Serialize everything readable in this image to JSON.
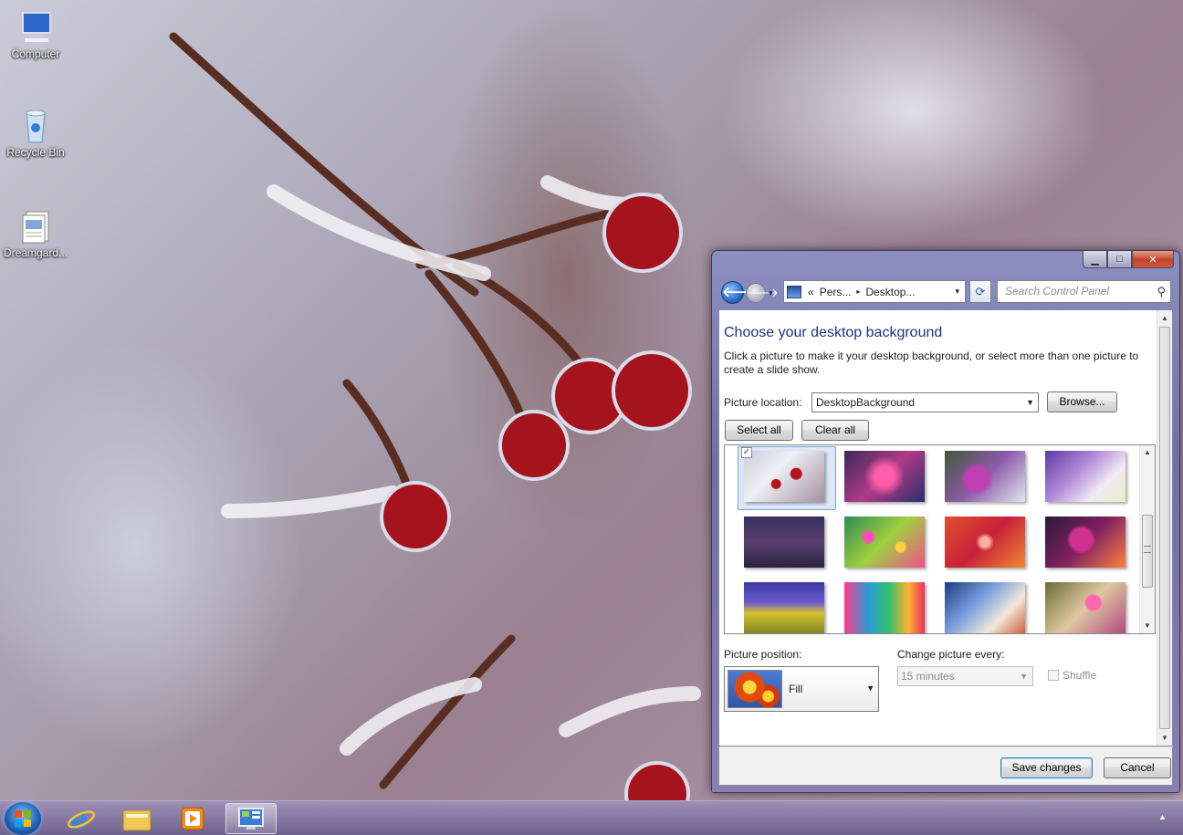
{
  "desktop": {
    "icons": [
      {
        "label": "Computer",
        "icon": "computer-icon"
      },
      {
        "label": "Recycle Bin",
        "icon": "recycle-bin-icon"
      },
      {
        "label": "Dreamgard...",
        "icon": "document-icon"
      }
    ]
  },
  "window": {
    "caption_buttons": {
      "minimize": "▁",
      "maximize": "□",
      "close": "✕"
    },
    "nav": {
      "back": "🡐",
      "forward": "🡒",
      "address": {
        "overflow": "«",
        "segments": [
          "Pers...",
          "Desktop..."
        ],
        "separator": "▸",
        "dropdown": "▾"
      },
      "refresh": "⟳",
      "search_placeholder": "Search Control Panel",
      "search_icon": "⚲"
    },
    "heading": "Choose your desktop background",
    "description": "Click a picture to make it your desktop background, or select more than one picture to create a slide show.",
    "picture_location": {
      "label": "Picture location:",
      "value": "DesktopBackground",
      "browse": "Browse..."
    },
    "select_all": "Select all",
    "clear_all": "Clear all",
    "gallery": {
      "selected_index": 0,
      "tiles": [
        {
          "name": "frost-berries",
          "checked": true
        },
        {
          "name": "pink-blossom"
        },
        {
          "name": "purple-flowers"
        },
        {
          "name": "lilac-branches"
        },
        {
          "name": "dusk-grass"
        },
        {
          "name": "colorful-meadow"
        },
        {
          "name": "red-bokeh"
        },
        {
          "name": "magenta-flower"
        },
        {
          "name": "golden-grass"
        },
        {
          "name": "rainbow-reeds"
        },
        {
          "name": "blue-twigs"
        },
        {
          "name": "pink-cosmos"
        }
      ]
    },
    "picture_position": {
      "label": "Picture position:",
      "value": "Fill"
    },
    "change_every": {
      "label": "Change picture every:",
      "value": "15 minutes"
    },
    "shuffle": {
      "label": "Shuffle",
      "checked": false
    },
    "save": "Save changes",
    "cancel": "Cancel"
  },
  "taskbar": {
    "apps": [
      {
        "name": "internet-explorer",
        "active": false
      },
      {
        "name": "file-explorer",
        "active": false
      },
      {
        "name": "media-player",
        "active": false
      },
      {
        "name": "control-panel",
        "active": true
      }
    ],
    "tray_arrow": "▲"
  }
}
